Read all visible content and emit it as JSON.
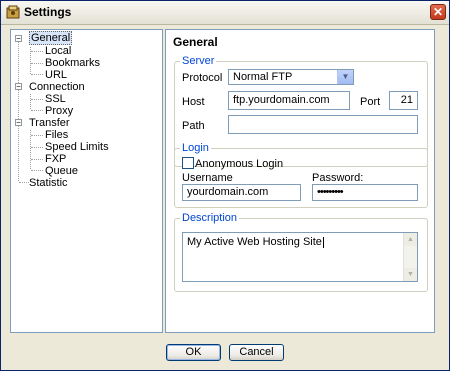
{
  "window": {
    "title": "Settings",
    "close_glyph": "✕"
  },
  "tree": {
    "items": [
      {
        "label": "General",
        "selected": true
      },
      {
        "label": "Local"
      },
      {
        "label": "Bookmarks"
      },
      {
        "label": "URL"
      },
      {
        "label": "Connection"
      },
      {
        "label": "SSL"
      },
      {
        "label": "Proxy"
      },
      {
        "label": "Transfer"
      },
      {
        "label": "Files"
      },
      {
        "label": "Speed Limits"
      },
      {
        "label": "FXP"
      },
      {
        "label": "Queue"
      },
      {
        "label": "Statistic"
      }
    ]
  },
  "pane": {
    "title": "General",
    "server": {
      "legend": "Server",
      "protocol_label": "Protocol",
      "protocol_value": "Normal FTP",
      "host_label": "Host",
      "host_value": "ftp.yourdomain.com",
      "port_label": "Port",
      "port_value": "21",
      "path_label": "Path",
      "path_value": ""
    },
    "login": {
      "legend": "Login",
      "anonymous_label": "Anonymous Login",
      "anonymous_checked": false,
      "username_label": "Username",
      "username_value": "yourdomain.com",
      "password_label": "Password:",
      "password_value": "•••••••••"
    },
    "description": {
      "legend": "Description",
      "value": "My Active Web Hosting Site"
    }
  },
  "buttons": {
    "ok": "OK",
    "cancel": "Cancel"
  },
  "colors": {
    "accent": "#0046d5",
    "window_bg": "#ece9d8",
    "border": "#7f9db9",
    "close": "#c2391b"
  }
}
